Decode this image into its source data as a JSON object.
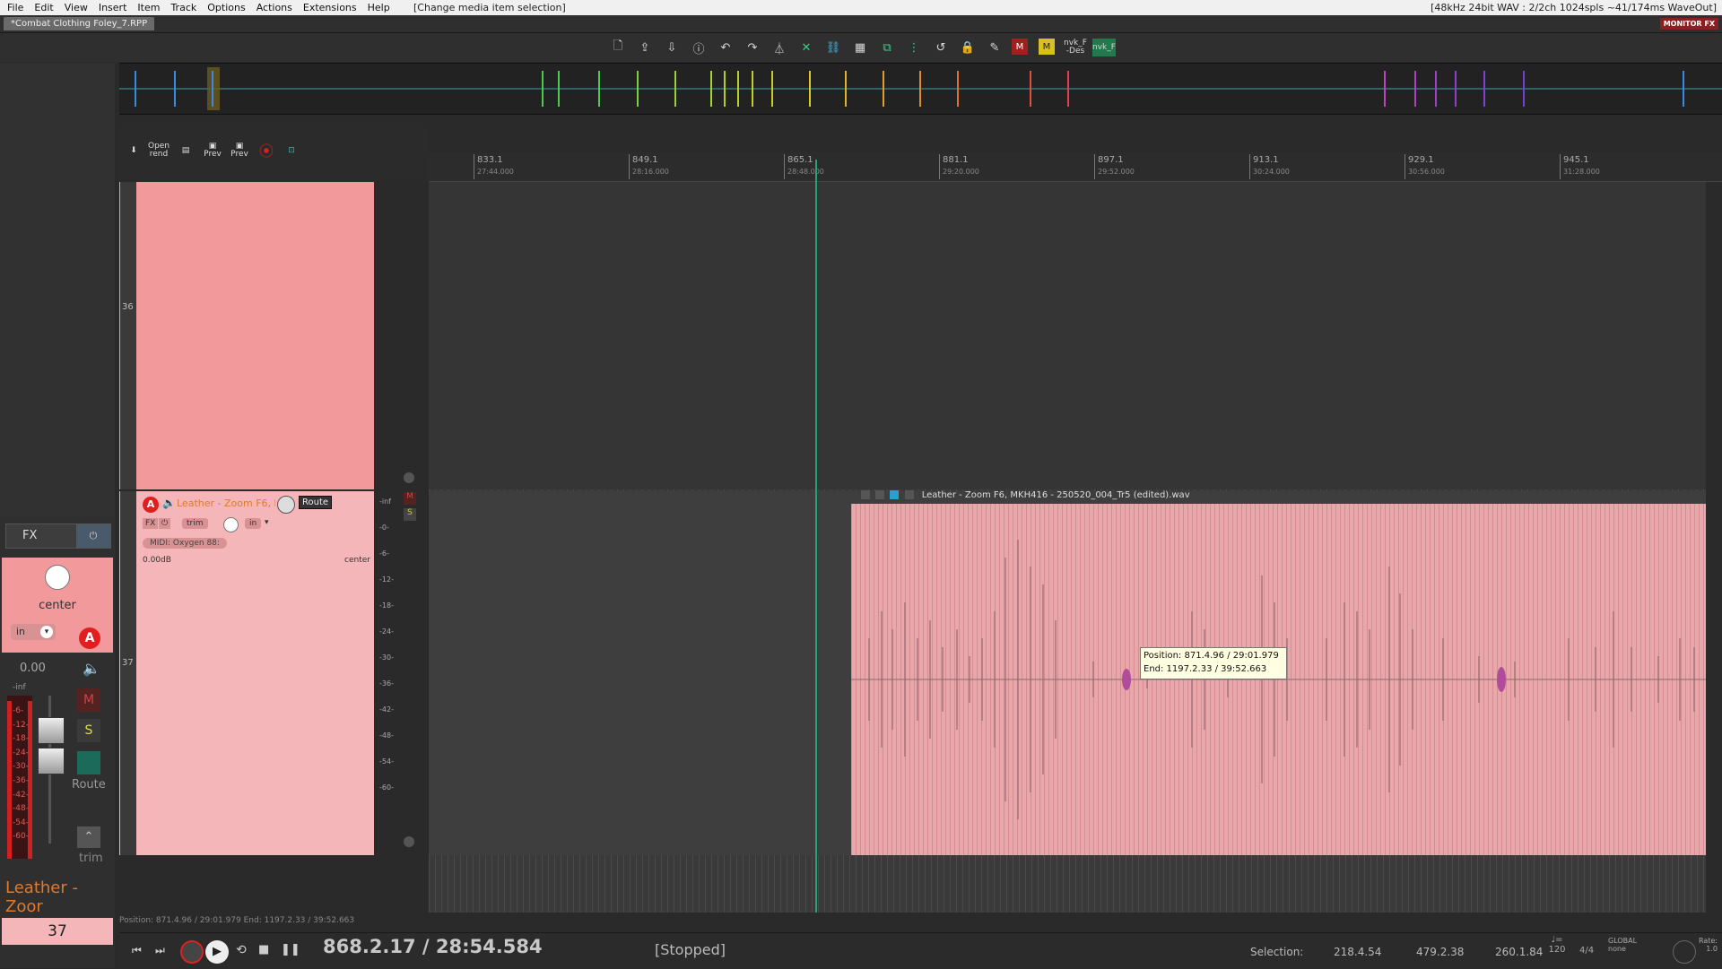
{
  "menubar": {
    "items": [
      "File",
      "Edit",
      "View",
      "Insert",
      "Item",
      "Track",
      "Options",
      "Actions",
      "Extensions",
      "Help"
    ],
    "status": "[Change media item selection]",
    "audio_info": "[48kHz 24bit WAV : 2/2ch 1024spls ~41/174ms WaveOut]"
  },
  "project": {
    "tab_label": "*Combat Clothing Foley_7.RPP",
    "monitor_fx": "MONITOR FX"
  },
  "toolbar": {
    "labels": [
      "nvk_F -Des",
      "nvk_F"
    ]
  },
  "tcp_toolbar": {
    "open_rend": "Open rend",
    "prev1": "Prev",
    "prev2": "Prev"
  },
  "ruler": {
    "ticks": [
      {
        "bar": "833.1",
        "time": "27:44.000"
      },
      {
        "bar": "849.1",
        "time": "28:16.000"
      },
      {
        "bar": "865.1",
        "time": "28:48.000"
      },
      {
        "bar": "881.1",
        "time": "29:20.000"
      },
      {
        "bar": "897.1",
        "time": "29:52.000"
      },
      {
        "bar": "913.1",
        "time": "30:24.000"
      },
      {
        "bar": "929.1",
        "time": "30:56.000"
      },
      {
        "bar": "945.1",
        "time": "31:28.000"
      }
    ]
  },
  "tracks": [
    {
      "number": "36"
    },
    {
      "number": "37",
      "name": "Leather - Zoom F6, MKH4",
      "route_label": "Route",
      "fx_label": "FX",
      "trim_label": "trim",
      "in_label": "in",
      "midi_input": "MIDI: Oxygen 88:",
      "volume": "0.00dB",
      "pan": "center"
    }
  ],
  "meter_scale": [
    "-inf",
    "-0-",
    "-6-",
    "-12-",
    "-18-",
    "-24-",
    "-30-",
    "-36-",
    "-42-",
    "-48-",
    "-54-",
    "-60-"
  ],
  "media_item": {
    "name": "Leather - Zoom F6, MKH416 - 250520_004_Tr5 (edited).wav"
  },
  "tooltip": {
    "position": "Position: 871.4.96 / 29:01.979",
    "end": "End: 1197.2.33 / 39:52.663"
  },
  "mcp": {
    "fx_label": "FX",
    "pan": "center",
    "in_label": "in",
    "volume": "0.00",
    "vol_inf": "-inf",
    "route_label": "Route",
    "trim_label": "trim",
    "name": "Leather - Zoor",
    "number": "37",
    "meter_scale": [
      "-6-",
      "-12-",
      "-18-",
      "-24-",
      "-30-",
      "-36-",
      "-42-",
      "-48-",
      "-54-",
      "-60-"
    ]
  },
  "status_line": "Position: 871.4.96 / 29:01.979 End: 1197.2.33 / 39:52.663",
  "transport": {
    "time": "868.2.17 / 28:54.584",
    "state": "[Stopped]",
    "selection_label": "Selection:",
    "sel_start": "218.4.54",
    "sel_end": "479.2.38",
    "sel_length": "260.1.84",
    "bpm_label": "♩=",
    "bpm": "120",
    "time_sig": "4/4",
    "global_label": "GLOBAL",
    "global_value": "none",
    "rate_label": "Rate:",
    "rate": "1.0"
  },
  "colors": {
    "track36": "#f2999b",
    "track37": "#f4b6b8",
    "item": "#e8a7aa",
    "cursor": "#2aa078",
    "record": "#e02020",
    "name_orange": "#e07a2c"
  }
}
